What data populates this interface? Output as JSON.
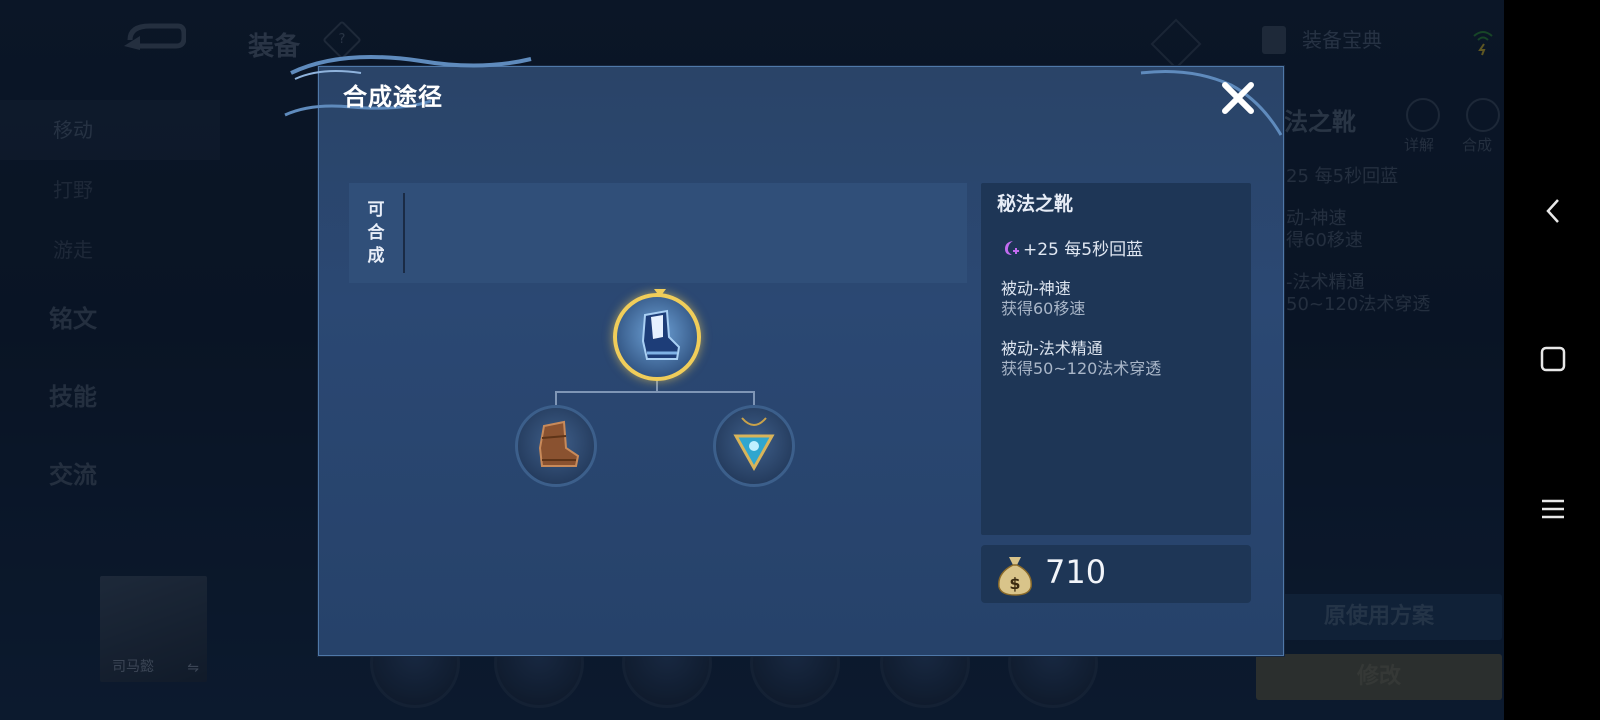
{
  "background": {
    "section_title": "装备",
    "help_badge": "?",
    "nav_items": [
      {
        "label": "移动",
        "active": true,
        "big": false
      },
      {
        "label": "打野",
        "active": false,
        "big": false
      },
      {
        "label": "游走",
        "active": false,
        "big": false
      },
      {
        "label": "铭文",
        "active": false,
        "big": true
      },
      {
        "label": "技能",
        "active": false,
        "big": true
      },
      {
        "label": "交流",
        "active": false,
        "big": true
      }
    ],
    "hero_name": "司马懿",
    "hero_swap": "⇋",
    "encyclopedia_label": "装备宝典",
    "right_fragments": {
      "item_title": "法之靴",
      "detail_label": "详解",
      "combine_label": "合成",
      "stat": "25 每5秒回蓝",
      "passive1_title": "动-神速",
      "passive1_desc": "得60移速",
      "passive2_title": "-法术精通",
      "passive2_desc": "50~120法术穿透"
    },
    "plan_button": "原使用方案",
    "edit_button": "修改"
  },
  "modal": {
    "title": "合成途径",
    "synth_label_lines": [
      "可",
      "合",
      "成"
    ],
    "detail": {
      "item_name": "秘法之靴",
      "stat": "+25 每5秒回蓝",
      "passives": [
        {
          "title": "被动-神速",
          "desc": "获得60移速"
        },
        {
          "title": "被动-法术精通",
          "desc": "获得50~120法术穿透"
        }
      ]
    },
    "price": "710",
    "tree": {
      "main_item": "arcane-boots-icon",
      "components": [
        "leather-boots-icon",
        "mana-pendant-icon"
      ]
    }
  },
  "colors": {
    "accent_gold": "#f0cd5a",
    "mana_purple": "#c36cf0",
    "modal_bg": "#2b4873"
  }
}
